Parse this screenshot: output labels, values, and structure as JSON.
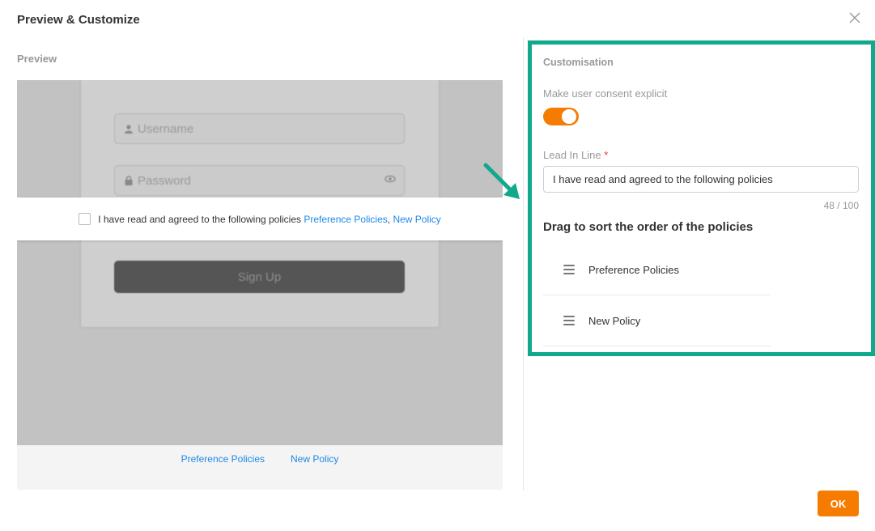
{
  "dialog": {
    "title": "Preview & Customize",
    "ok_label": "OK"
  },
  "preview": {
    "label": "Preview",
    "username_placeholder": "Username",
    "password_placeholder": "Password",
    "signup_label": "Sign Up",
    "consent_text": "I have read and agreed to the following policies",
    "consent_links": [
      "Preference Policies",
      "New Policy"
    ],
    "consent_separator": ",",
    "footer_links": [
      "Preference Policies",
      "New Policy"
    ]
  },
  "customisation": {
    "title": "Customisation",
    "explicit_label": "Make user consent explicit",
    "explicit_on": true,
    "leadin_label": "Lead In Line",
    "required_mark": "*",
    "leadin_value": "I have read and agreed to the following policies",
    "char_count": "48 / 100",
    "drag_title": "Drag to sort the order of the policies",
    "policies": [
      "Preference Policies",
      "New Policy"
    ]
  },
  "colors": {
    "accent": "#f57c00",
    "highlight_border": "#10a98c",
    "link": "#1e88e5"
  },
  "icons": {
    "close": "close-icon",
    "user": "user-icon",
    "lock": "lock-icon",
    "eye": "eye-icon",
    "drag": "drag-handle-icon",
    "arrow": "arrow-icon"
  }
}
